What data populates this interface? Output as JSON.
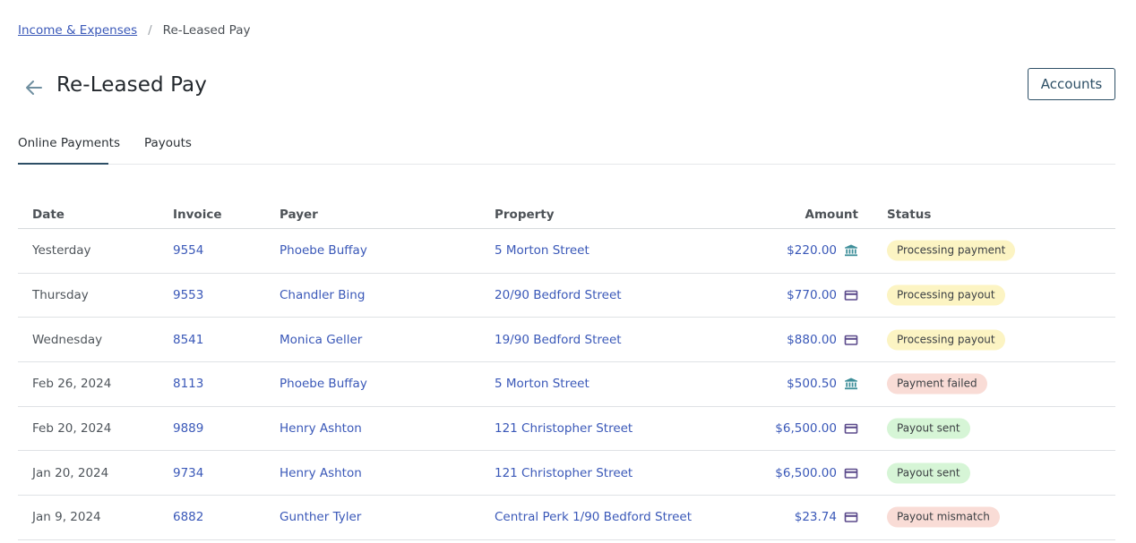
{
  "breadcrumb": {
    "parent": "Income & Expenses",
    "separator": "/",
    "current": "Re-Leased Pay"
  },
  "header": {
    "title": "Re-Leased Pay",
    "back_icon": "arrow-left-icon",
    "accounts_label": "Accounts"
  },
  "tabs": [
    {
      "label": "Online Payments",
      "active": true
    },
    {
      "label": "Payouts",
      "active": false
    }
  ],
  "table": {
    "columns": [
      "Date",
      "Invoice",
      "Payer",
      "Property",
      "Amount",
      "Status"
    ],
    "rows": [
      {
        "date": "Yesterday",
        "invoice": "9554",
        "payer": "Phoebe Buffay",
        "property": "5 Morton Street",
        "amount": "$220.00",
        "method_icon": "bank-icon",
        "status": "Processing payment",
        "status_kind": "processing"
      },
      {
        "date": "Thursday",
        "invoice": "9553",
        "payer": "Chandler Bing",
        "property": "20/90 Bedford Street",
        "amount": "$770.00",
        "method_icon": "card-icon",
        "status": "Processing payout",
        "status_kind": "processing"
      },
      {
        "date": "Wednesday",
        "invoice": "8541",
        "payer": "Monica Geller",
        "property": "19/90 Bedford Street",
        "amount": "$880.00",
        "method_icon": "card-icon",
        "status": "Processing payout",
        "status_kind": "processing"
      },
      {
        "date": "Feb 26, 2024",
        "invoice": "8113",
        "payer": "Phoebe Buffay",
        "property": "5 Morton Street",
        "amount": "$500.50",
        "method_icon": "bank-icon",
        "status": "Payment failed",
        "status_kind": "failed"
      },
      {
        "date": "Feb 20, 2024",
        "invoice": "9889",
        "payer": "Henry Ashton",
        "property": "121 Christopher Street",
        "amount": "$6,500.00",
        "method_icon": "card-icon",
        "status": "Payout sent",
        "status_kind": "sent"
      },
      {
        "date": "Jan 20, 2024",
        "invoice": "9734",
        "payer": "Henry Ashton",
        "property": "121 Christopher Street",
        "amount": "$6,500.00",
        "method_icon": "card-icon",
        "status": "Payout sent",
        "status_kind": "sent"
      },
      {
        "date": "Jan 9, 2024",
        "invoice": "6882",
        "payer": "Gunther Tyler",
        "property": "Central Perk 1/90 Bedford Street",
        "amount": "$23.74",
        "method_icon": "card-icon",
        "status": "Payout mismatch",
        "status_kind": "failed"
      }
    ]
  },
  "colors": {
    "link": "#3a58b8",
    "accent": "#2d4f66",
    "bank_icon": "#3f8f9a",
    "card_icon": "#5b4a8b",
    "processing_bg": "#fcf4c3",
    "failed_bg": "#f9dcd6",
    "sent_bg": "#d6f5d6"
  }
}
